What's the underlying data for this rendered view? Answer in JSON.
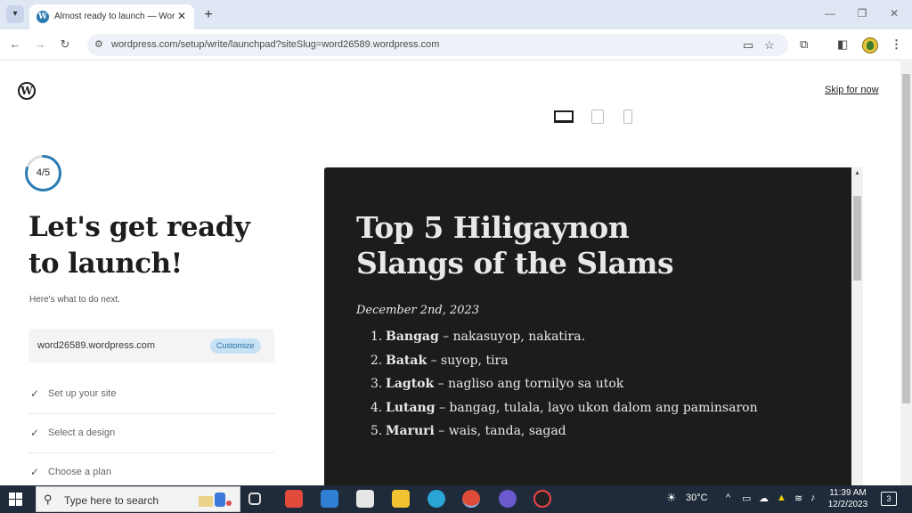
{
  "browser": {
    "tab_title": "Almost ready to launch — WordPress.com",
    "tab_close": "✕",
    "new_tab": "+",
    "url": "wordpress.com/setup/write/launchpad?siteSlug=word26589.wordpress.com",
    "window_controls": [
      "—",
      "❐",
      "✕"
    ]
  },
  "page": {
    "skip_link": "Skip for now",
    "progress": {
      "label": "4/5",
      "fraction": 0.8
    },
    "heading": "Let's get ready to launch!",
    "subtext": "Here's what to do next.",
    "site_card": {
      "domain": "word26589.wordpress.com",
      "customize": "Customize"
    },
    "tasks": [
      {
        "label": "Set up your site"
      },
      {
        "label": "Select a design"
      },
      {
        "label": "Choose a plan"
      }
    ],
    "preview": {
      "title": "Top 5 Hiligaynon Slangs of the Slams",
      "date": "December 2nd, 2023",
      "items": [
        {
          "num": "1.",
          "term": "Bangag",
          "meaning": " – nakasuyop, nakatira."
        },
        {
          "num": "2.",
          "term": "Batak",
          "meaning": " – suyop, tira"
        },
        {
          "num": "3.",
          "term": "Lagtok",
          "meaning": " – nagliso ang tornilyo sa utok"
        },
        {
          "num": "4.",
          "term": "Lutang",
          "meaning": " – bangag, tulala, layo ukon dalom ang paminsaron"
        },
        {
          "num": "5.",
          "term": "Maruri",
          "meaning": " – wais, tanda, sagad"
        }
      ]
    }
  },
  "taskbar": {
    "search_placeholder": "Type here to search",
    "weather": "30°C",
    "time": "11:39 AM",
    "date": "12/2/2023",
    "notifications": "3"
  },
  "colors": {
    "accent_blue": "#2c7cb3",
    "preview_bg": "#1c1c1c",
    "taskbar_bg": "#1f2a3a"
  }
}
